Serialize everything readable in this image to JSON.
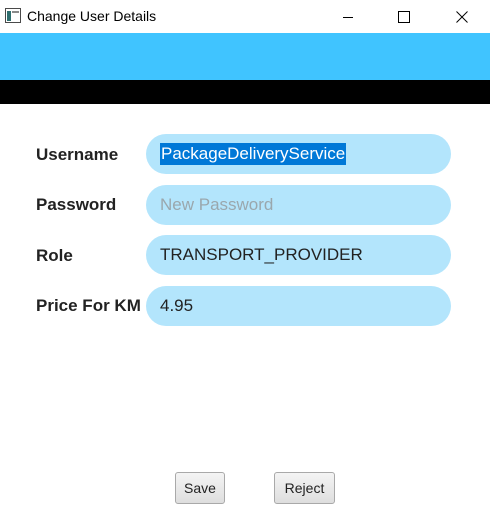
{
  "window": {
    "title": "Change User Details",
    "controls": [
      "minimize-icon",
      "maximize-icon",
      "close-icon"
    ]
  },
  "colors": {
    "banner": "#40c4ff",
    "field_background": "#b3e5fc",
    "selection": "#0078d7"
  },
  "form": {
    "username": {
      "label": "Username",
      "value": "PackageDeliveryService",
      "selected": true
    },
    "password": {
      "label": "Password",
      "value": "",
      "placeholder": "New Password"
    },
    "role": {
      "label": "Role",
      "value": "TRANSPORT_PROVIDER"
    },
    "price": {
      "label": "Price For KM",
      "value": "4.95"
    }
  },
  "buttons": {
    "save": "Save",
    "reject": "Reject"
  }
}
